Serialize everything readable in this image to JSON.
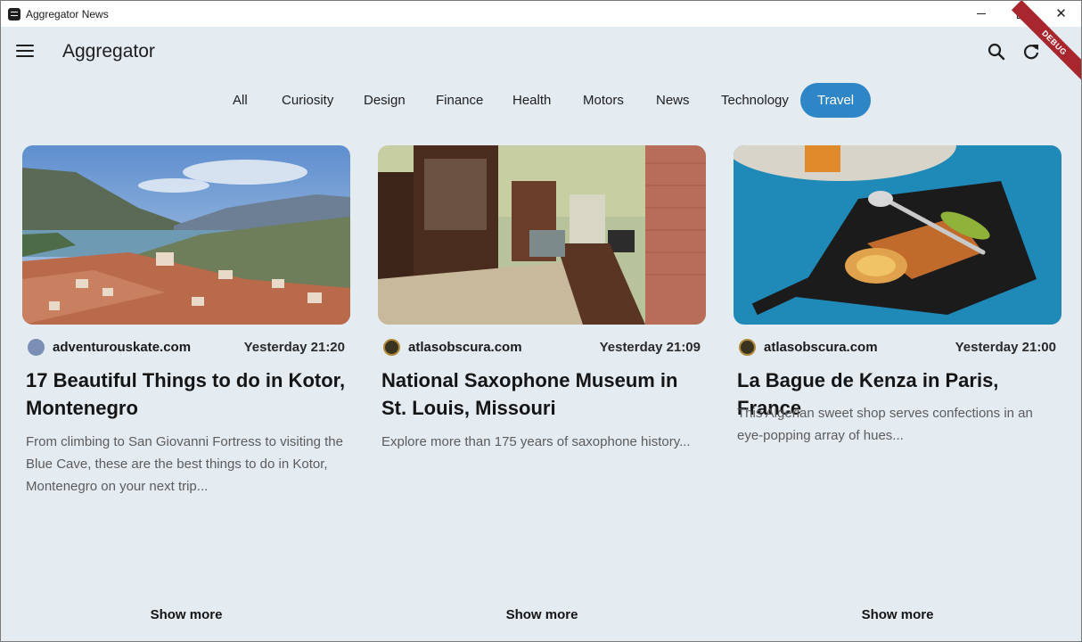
{
  "window": {
    "title": "Aggregator News"
  },
  "appbar": {
    "title": "Aggregator",
    "debug_label": "DEBUG"
  },
  "categories": [
    "All",
    "Curiosity",
    "Design",
    "Finance",
    "Health",
    "Motors",
    "News",
    "Technology",
    "Travel"
  ],
  "active_category": "Travel",
  "colors": {
    "accent": "#2f86c6",
    "background": "#e4ebf1",
    "debug": "#a8262d"
  },
  "articles": [
    {
      "source": "adventurouskate.com",
      "time": "Yesterday 21:20",
      "title": "17 Beautiful Things to do in Kotor, Montenegro",
      "description": "From climbing to San Giovanni Fortress to visiting the Blue Cave, these are the best things to do in Kotor, Montenegro on your next trip...",
      "show_more": "Show more"
    },
    {
      "source": "atlasobscura.com",
      "time": "Yesterday 21:09",
      "title": "National Saxophone Museum in St. Louis, Missouri",
      "description": "Explore more than 175 years of saxophone history...",
      "show_more": "Show more"
    },
    {
      "source": "atlasobscura.com",
      "time": "Yesterday 21:00",
      "title": "La Bague de Kenza in Paris, France",
      "description": "This Algerian sweet shop serves confections in an eye-popping array of hues...",
      "show_more": "Show more"
    }
  ]
}
